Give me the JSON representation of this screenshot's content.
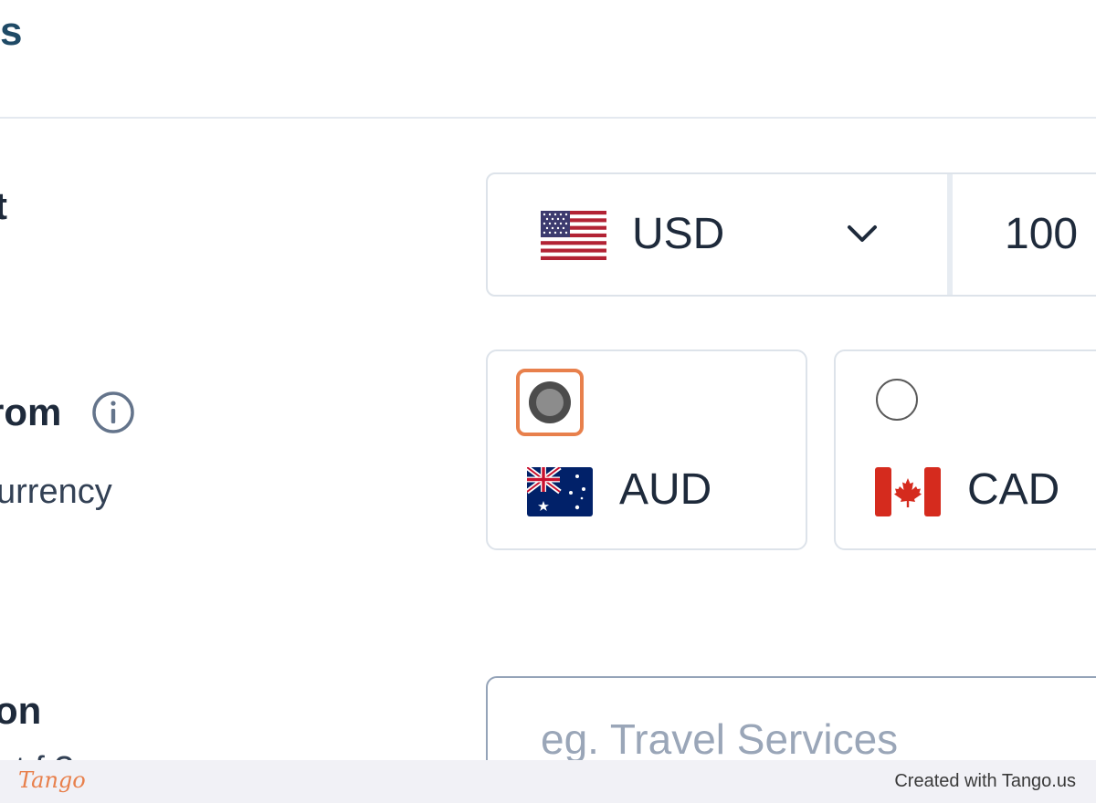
{
  "header": {
    "title_fragment": "s"
  },
  "form": {
    "amount_label_fragment": "t",
    "from_label_fragment": "rom",
    "from_sublabel_fragment": "urrency",
    "description_label_fragment": "on",
    "description_sublabel_fragment": "nt f   ?"
  },
  "amount": {
    "currency": {
      "code": "USD",
      "flag": "us-flag-icon"
    },
    "value": "100"
  },
  "from_currency": {
    "options": [
      {
        "code": "AUD",
        "flag": "australia-flag-icon",
        "selected": true
      },
      {
        "code": "CAD",
        "flag": "canada-flag-icon",
        "selected": false
      }
    ]
  },
  "description": {
    "placeholder": "eg. Travel Services",
    "value": ""
  },
  "footer": {
    "logo": "Tango",
    "credit": "Created with Tango.us"
  },
  "colors": {
    "highlight": "#e8804c",
    "title": "#1f4a66",
    "text": "#1e2a3b",
    "border": "#dde3ea"
  }
}
